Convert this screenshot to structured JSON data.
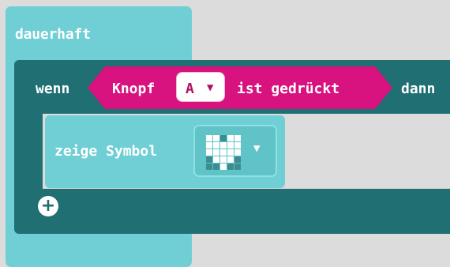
{
  "blocks": {
    "forever": {
      "label": "dauerhaft",
      "color": "#6fcfd4"
    },
    "if_block": {
      "label_if": "wenn",
      "label_then": "dann",
      "color": "#1f6f73"
    },
    "condition": {
      "label_prefix": "Knopf",
      "button_value": "A",
      "label_suffix": "ist gedrückt",
      "color": "#d8127e"
    },
    "show_icon": {
      "label": "zeige Symbol",
      "icon": "heart-icon",
      "icon_pattern": [
        [
          1,
          1,
          0,
          1,
          1
        ],
        [
          1,
          1,
          1,
          1,
          1
        ],
        [
          1,
          1,
          1,
          1,
          1
        ],
        [
          0,
          1,
          1,
          1,
          0
        ],
        [
          0,
          0,
          1,
          0,
          0
        ]
      ]
    },
    "add_button": {
      "icon": "plus-circle-icon",
      "glyph": "+"
    }
  },
  "icons": {
    "dropdown_caret": "▼"
  }
}
